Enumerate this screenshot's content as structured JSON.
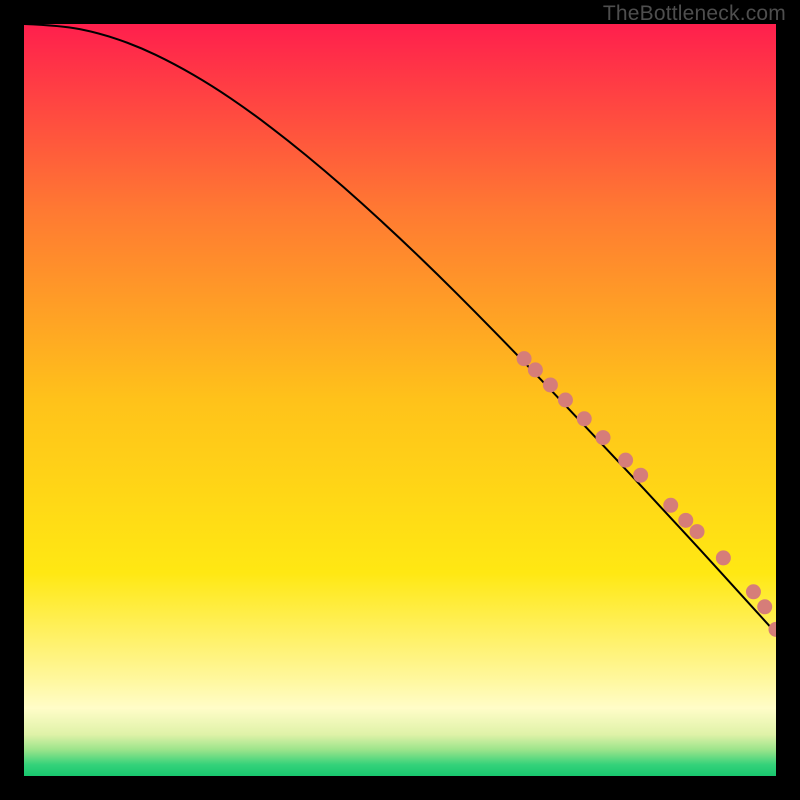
{
  "attribution": "TheBottleneck.com",
  "chart_data": {
    "type": "line",
    "title": "",
    "xlabel": "",
    "ylabel": "",
    "xlim": [
      0,
      1
    ],
    "ylim": [
      0,
      1
    ],
    "series": [
      {
        "name": "curve",
        "x": [
          0.0,
          0.05,
          0.1,
          0.15,
          0.2,
          0.25,
          0.3,
          0.35,
          0.4,
          0.45,
          0.5,
          0.55,
          0.6,
          0.65,
          0.7,
          0.75,
          0.8,
          0.85,
          0.9,
          0.95,
          1.0
        ],
        "y": [
          1.0,
          0.998,
          0.988,
          0.971,
          0.947,
          0.918,
          0.884,
          0.846,
          0.805,
          0.761,
          0.715,
          0.667,
          0.617,
          0.566,
          0.514,
          0.461,
          0.408,
          0.354,
          0.3,
          0.245,
          0.19
        ]
      },
      {
        "name": "highlighted-points",
        "x": [
          0.665,
          0.68,
          0.7,
          0.72,
          0.745,
          0.77,
          0.8,
          0.82,
          0.86,
          0.88,
          0.895,
          0.93,
          0.97,
          0.985,
          1.0
        ],
        "y": [
          0.555,
          0.54,
          0.52,
          0.5,
          0.475,
          0.45,
          0.42,
          0.4,
          0.36,
          0.34,
          0.325,
          0.29,
          0.245,
          0.225,
          0.195
        ]
      }
    ],
    "background_gradient": {
      "stops": [
        {
          "y": 1.0,
          "color": "#ff1f4d"
        },
        {
          "y": 0.75,
          "color": "#ff7a32"
        },
        {
          "y": 0.5,
          "color": "#ffc21a"
        },
        {
          "y": 0.27,
          "color": "#ffe813"
        },
        {
          "y": 0.13,
          "color": "#fff79c"
        },
        {
          "y": 0.09,
          "color": "#fffdc8"
        },
        {
          "y": 0.055,
          "color": "#dff2a8"
        },
        {
          "y": 0.035,
          "color": "#9ce48b"
        },
        {
          "y": 0.015,
          "color": "#34d27a"
        },
        {
          "y": 0.0,
          "color": "#18c76f"
        }
      ]
    },
    "point_color": "#d67d79",
    "curve_color": "#000000"
  }
}
